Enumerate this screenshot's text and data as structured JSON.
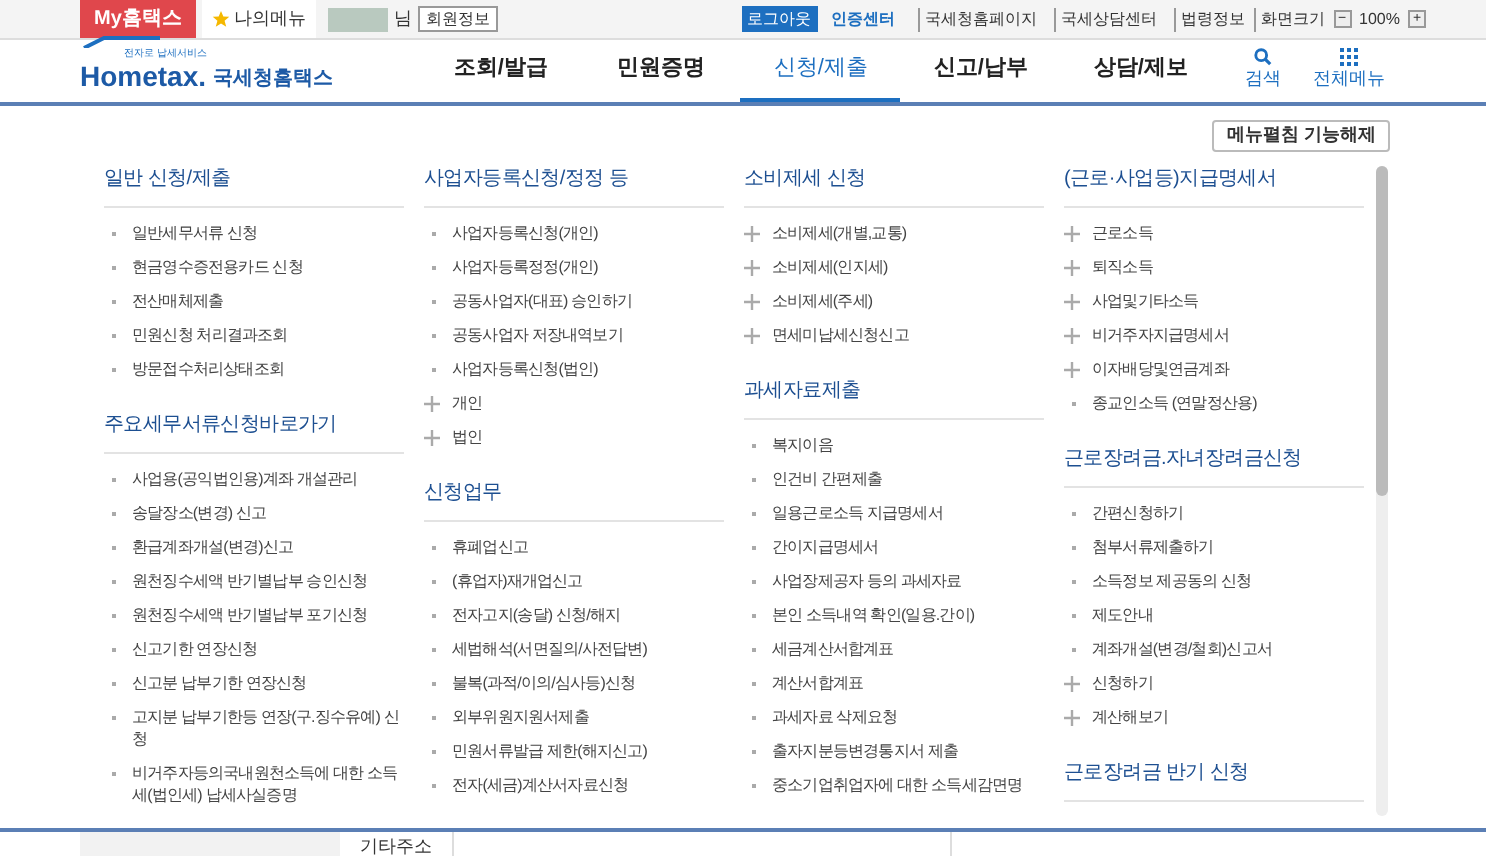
{
  "top_bar": {
    "my_hometax": "My홈택스",
    "my_menu": "나의메뉴",
    "user_suffix": "님",
    "member_info": "회원정보",
    "logout": "로그아웃",
    "cert_center": "인증센터",
    "links": [
      "국세청홈페이지",
      "국세상담센터",
      "법령정보"
    ],
    "zoom_label": "화면크기",
    "zoom_minus": "−",
    "zoom_value": "100%",
    "zoom_plus": "+"
  },
  "logo": {
    "tagline": "전자로 납세서비스",
    "brand": "Hometax.",
    "name": "국세청홈택스"
  },
  "nav": [
    {
      "label": "조회/발급",
      "selected": false
    },
    {
      "label": "민원증명",
      "selected": false
    },
    {
      "label": "신청/제출",
      "selected": true
    },
    {
      "label": "신고/납부",
      "selected": false
    },
    {
      "label": "상담/제보",
      "selected": false
    }
  ],
  "search": "검색",
  "all_menu": "전체메뉴",
  "collapse_button": "메뉴펼침 기능해제",
  "columns": [
    [
      {
        "title": "일반 신청/제출",
        "items": [
          {
            "kind": "dot",
            "label": "일반세무서류 신청"
          },
          {
            "kind": "dot",
            "label": "현금영수증전용카드 신청"
          },
          {
            "kind": "dot",
            "label": "전산매체제출"
          },
          {
            "kind": "dot",
            "label": "민원신청 처리결과조회"
          },
          {
            "kind": "dot",
            "label": "방문접수처리상태조회"
          }
        ]
      },
      {
        "title": "주요세무서류신청바로가기",
        "items": [
          {
            "kind": "dot",
            "label": "사업용(공익법인용)계좌 개설관리"
          },
          {
            "kind": "dot",
            "label": "송달장소(변경) 신고"
          },
          {
            "kind": "dot",
            "label": "환급계좌개설(변경)신고"
          },
          {
            "kind": "dot",
            "label": "원천징수세액 반기별납부 승인신청"
          },
          {
            "kind": "dot",
            "label": "원천징수세액 반기별납부 포기신청"
          },
          {
            "kind": "dot",
            "label": "신고기한 연장신청"
          },
          {
            "kind": "dot",
            "label": "신고분 납부기한 연장신청"
          },
          {
            "kind": "dot",
            "label": "고지분 납부기한등 연장(구.징수유예) 신청"
          },
          {
            "kind": "dot",
            "label": "비거주자등의국내원천소득에 대한 소득세(법인세) 납세사실증명"
          }
        ]
      }
    ],
    [
      {
        "title": "사업자등록신청/정정 등",
        "items": [
          {
            "kind": "dot",
            "label": "사업자등록신청(개인)"
          },
          {
            "kind": "dot",
            "label": "사업자등록정정(개인)"
          },
          {
            "kind": "dot",
            "label": "공동사업자(대표) 승인하기"
          },
          {
            "kind": "dot",
            "label": "공동사업자 저장내역보기"
          },
          {
            "kind": "dot",
            "label": "사업자등록신청(법인)"
          },
          {
            "kind": "plus",
            "label": "개인"
          },
          {
            "kind": "plus",
            "label": "법인"
          }
        ]
      },
      {
        "title": "신청업무",
        "items": [
          {
            "kind": "dot",
            "label": "휴폐업신고"
          },
          {
            "kind": "dot",
            "label": "(휴업자)재개업신고"
          },
          {
            "kind": "dot",
            "label": "전자고지(송달) 신청/해지"
          },
          {
            "kind": "dot",
            "label": "세법해석(서면질의/사전답변)"
          },
          {
            "kind": "dot",
            "label": "불복(과적/이의/심사등)신청"
          },
          {
            "kind": "dot",
            "label": "외부위원지원서제출"
          },
          {
            "kind": "dot",
            "label": "민원서류발급 제한(해지신고)"
          },
          {
            "kind": "dot",
            "label": "전자(세금)계산서자료신청"
          }
        ]
      }
    ],
    [
      {
        "title": "소비제세 신청",
        "items": [
          {
            "kind": "plus",
            "label": "소비제세(개별,교통)"
          },
          {
            "kind": "plus",
            "label": "소비제세(인지세)"
          },
          {
            "kind": "plus",
            "label": "소비제세(주세)"
          },
          {
            "kind": "plus",
            "label": "면세미납세신청신고"
          }
        ]
      },
      {
        "title": "과세자료제출",
        "items": [
          {
            "kind": "dot",
            "label": "복지이음"
          },
          {
            "kind": "dot",
            "label": "인건비 간편제출"
          },
          {
            "kind": "dot",
            "label": "일용근로소득 지급명세서"
          },
          {
            "kind": "dot",
            "label": "간이지급명세서"
          },
          {
            "kind": "dot",
            "label": "사업장제공자 등의 과세자료"
          },
          {
            "kind": "dot",
            "label": "본인 소득내역 확인(일용.간이)"
          },
          {
            "kind": "dot",
            "label": "세금계산서합계표"
          },
          {
            "kind": "dot",
            "label": "계산서합계표"
          },
          {
            "kind": "dot",
            "label": "과세자료 삭제요청"
          },
          {
            "kind": "dot",
            "label": "출자지분등변경통지서 제출"
          },
          {
            "kind": "dot",
            "label": "중소기업취업자에 대한 소득세감면명"
          }
        ]
      }
    ],
    [
      {
        "title": "(근로·사업등)지급명세서",
        "items": [
          {
            "kind": "plus",
            "label": "근로소득"
          },
          {
            "kind": "plus",
            "label": "퇴직소득"
          },
          {
            "kind": "plus",
            "label": "사업및기타소득"
          },
          {
            "kind": "plus",
            "label": "비거주자지급명세서"
          },
          {
            "kind": "plus",
            "label": "이자배당및연금계좌"
          },
          {
            "kind": "dot",
            "label": "종교인소득 (연말정산용)"
          }
        ]
      },
      {
        "title": "근로장려금.자녀장려금신청",
        "items": [
          {
            "kind": "dot",
            "label": "간편신청하기"
          },
          {
            "kind": "dot",
            "label": "첨부서류제출하기"
          },
          {
            "kind": "dot",
            "label": "소득정보 제공동의 신청"
          },
          {
            "kind": "dot",
            "label": "제도안내"
          },
          {
            "kind": "dot",
            "label": "계좌개설(변경/철회)신고서"
          },
          {
            "kind": "plus",
            "label": "신청하기"
          },
          {
            "kind": "plus",
            "label": "계산해보기"
          }
        ]
      },
      {
        "title": "근로장려금 반기 신청"
      }
    ]
  ],
  "bottom": {
    "label": "기타주소"
  }
}
